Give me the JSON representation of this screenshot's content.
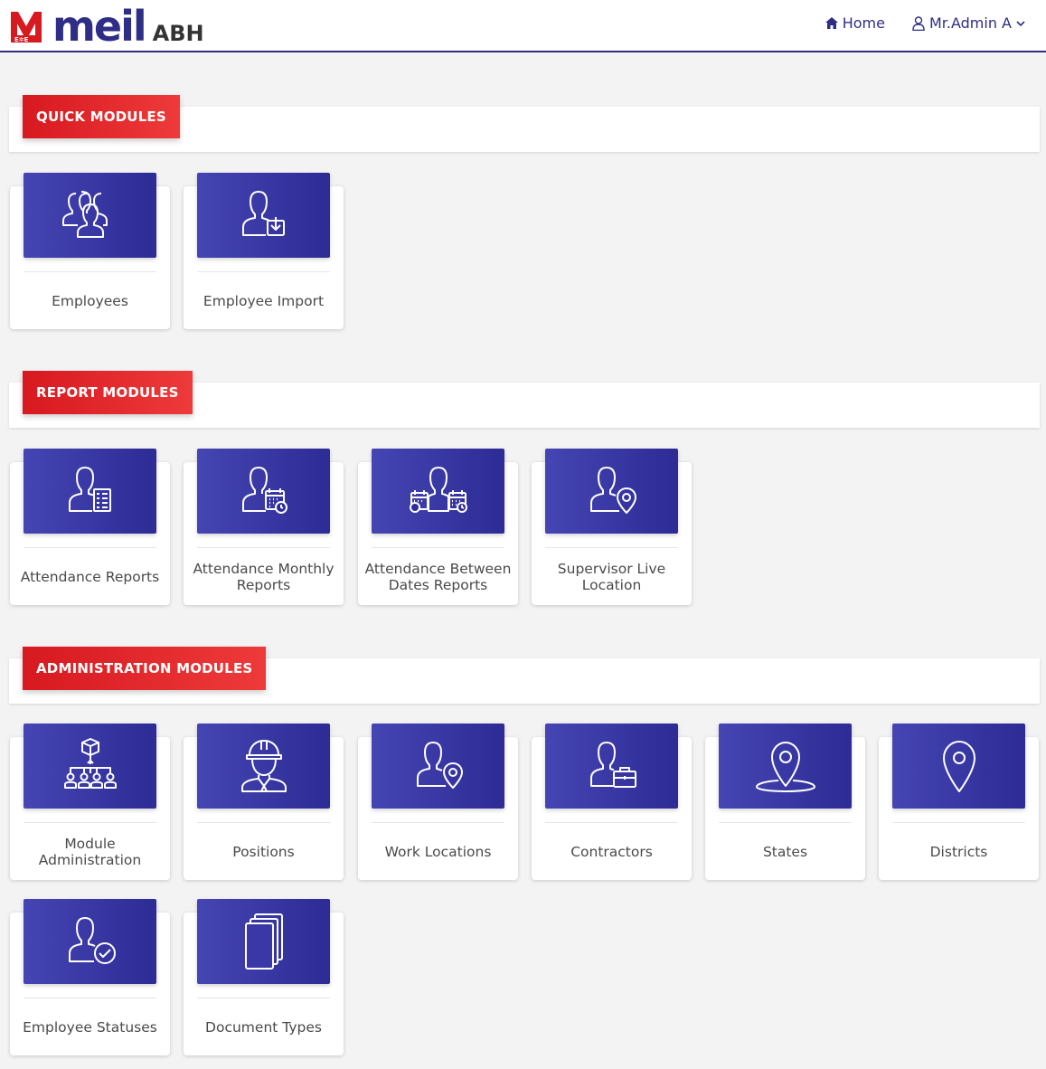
{
  "brand": {
    "name": "meil",
    "sub": "ABH",
    "colors": {
      "primary": "#2e2e86",
      "accent": "#d71920"
    }
  },
  "nav": {
    "home_label": "Home",
    "home_icon": "home-icon",
    "user_label": "Mr.Admin A",
    "user_icon": "user-icon",
    "caret_icon": "chevron-down-icon"
  },
  "sections": {
    "quick": {
      "title": "QUICK MODULES",
      "cards": [
        {
          "label": "Employees",
          "icon": "users-group-icon"
        },
        {
          "label": "Employee Import",
          "icon": "user-import-icon"
        }
      ]
    },
    "report": {
      "title": "REPORT MODULES",
      "cards": [
        {
          "label": "Attendance Reports",
          "icon": "user-report-icon"
        },
        {
          "label": "Attendance Monthly Reports",
          "icon": "user-calendar-icon"
        },
        {
          "label": "Attendance Between Dates Reports",
          "icon": "user-date-range-icon"
        },
        {
          "label": "Supervisor Live Location",
          "icon": "user-location-icon"
        }
      ]
    },
    "admin": {
      "title": "ADMINISTRATION MODULES",
      "cards": [
        {
          "label": "Module Administration",
          "icon": "hierarchy-icon"
        },
        {
          "label": "Positions",
          "icon": "worker-helmet-icon"
        },
        {
          "label": "Work Locations",
          "icon": "user-location-icon"
        },
        {
          "label": "Contractors",
          "icon": "user-briefcase-icon"
        },
        {
          "label": "States",
          "icon": "map-pin-base-icon"
        },
        {
          "label": "Districts",
          "icon": "map-pin-icon"
        },
        {
          "label": "Employee Statuses",
          "icon": "user-check-icon"
        },
        {
          "label": "Document Types",
          "icon": "documents-stack-icon"
        }
      ]
    }
  }
}
